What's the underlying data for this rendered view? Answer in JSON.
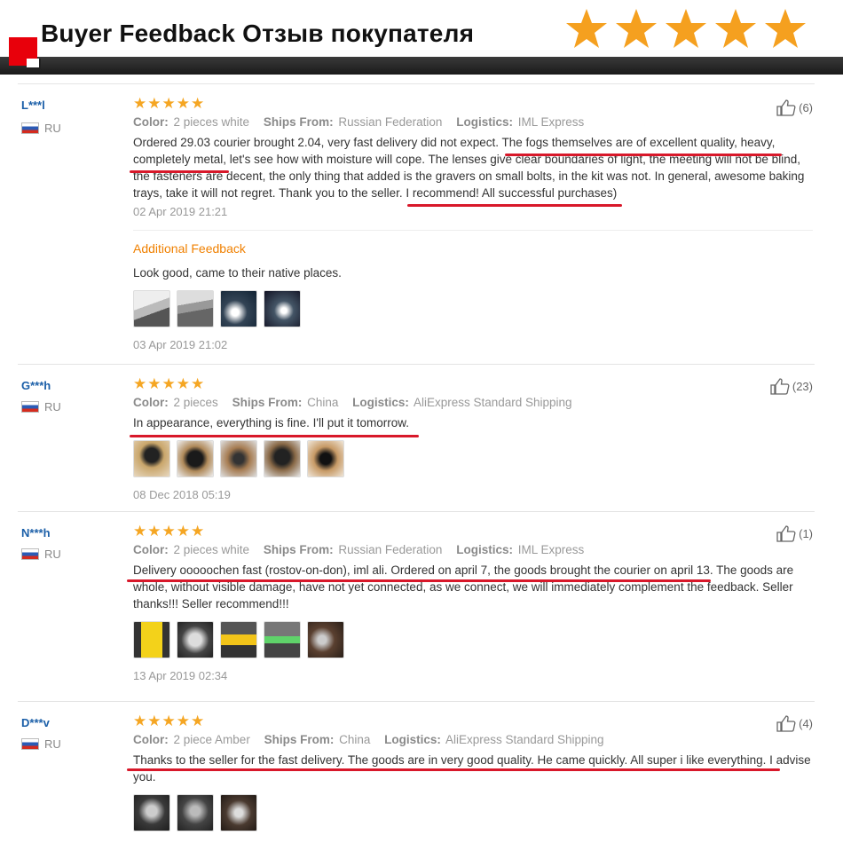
{
  "banner": {
    "title": "Buyer Feedback Отзыв покупателя",
    "star_count": 5,
    "star_color": "#f5a01f",
    "bar_color": "#222222",
    "accent_color": "#e8000b"
  },
  "labels": {
    "color": "Color:",
    "ships_from": "Ships From:",
    "logistics": "Logistics:",
    "additional_feedback": "Additional Feedback"
  },
  "colors": {
    "star": "#f5a623",
    "name_link": "#1b5fa8",
    "additional_label": "#f08000",
    "highlight_line": "#d8182a"
  },
  "reviews": [
    {
      "name": "L***l",
      "country": "RU",
      "rating": 5,
      "color": "2 pieces white",
      "ships_from": "Russian Federation",
      "logistics": "IML Express",
      "helpful_count": "(6)",
      "text": "Ordered 29.03 courier brought 2.04, very fast delivery did not expect. The fogs themselves are of excellent quality, heavy, completely metal, let's see how with moisture will cope. The lenses give clear boundaries of light, the meeting will not be blind, the fasteners are decent, the only thing that added is the gravers on small bolts, in the kit was not. In general, awesome baking trays, take it will not regret. Thank you to the seller. I recommend! All successful purchases)",
      "date": "02 Apr 2019 21:21",
      "additional": {
        "text": "Look good, came to their native places.",
        "date": "03 Apr 2019 21:02",
        "photo_count": 4
      },
      "photo_count": 0
    },
    {
      "name": "G***h",
      "country": "RU",
      "rating": 5,
      "color": "2 pieces",
      "ships_from": "China",
      "logistics": "AliExpress Standard Shipping",
      "helpful_count": "(23)",
      "text": "In appearance, everything is fine. I'll put it tomorrow.",
      "date": "08 Dec 2018 05:19",
      "photo_count": 5
    },
    {
      "name": "N***h",
      "country": "RU",
      "rating": 5,
      "color": "2 pieces white",
      "ships_from": "Russian Federation",
      "logistics": "IML Express",
      "helpful_count": "(1)",
      "text": "Delivery ooooochen fast (rostov-on-don), iml ali. Ordered on april 7, the goods brought the courier on april 13. The goods are whole, without visible damage, have not yet connected, as we connect, we will immediately complement the feedback. Seller thanks!!! Seller recommend!!!",
      "date": "13 Apr 2019 02:34",
      "photo_count": 5
    },
    {
      "name": "D***v",
      "country": "RU",
      "rating": 5,
      "color": "2 piece Amber",
      "ships_from": "China",
      "logistics": "AliExpress Standard Shipping",
      "helpful_count": "(4)",
      "text": "Thanks to the seller for the fast delivery. The goods are in very good quality. He came quickly. All super i like everything. I advise you.",
      "date": "",
      "photo_count": 3
    }
  ]
}
